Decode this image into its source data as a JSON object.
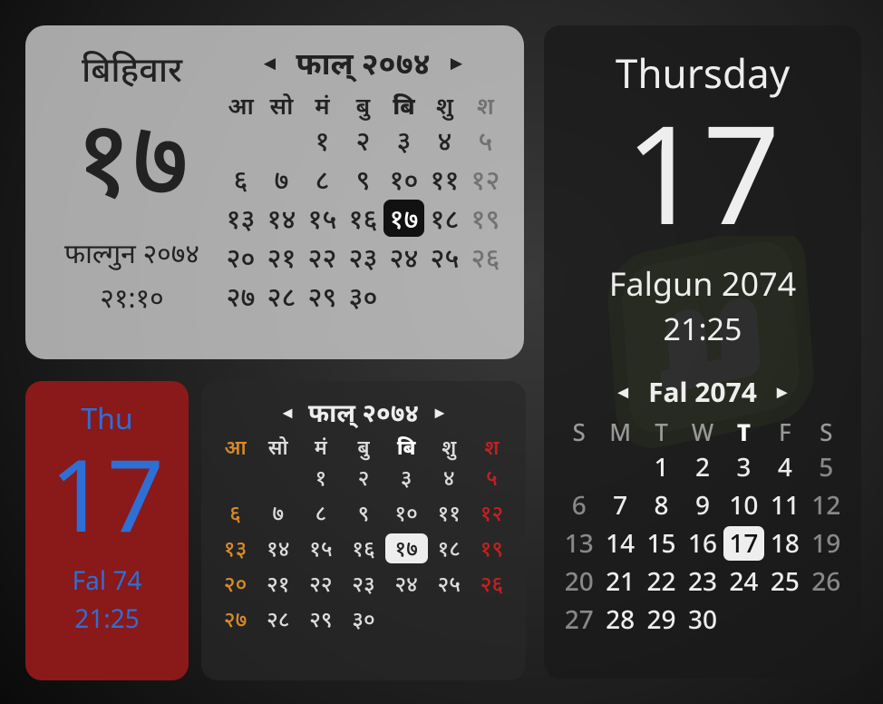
{
  "widget1": {
    "day_name": "बिहिवार",
    "big_date": "१७",
    "month_year": "फाल्गुन २०७४",
    "time": "२१:१०",
    "cal_title": "फाल् २०७४",
    "dow": [
      "आ",
      "सो",
      "मं",
      "बु",
      "बि",
      "शु",
      "श"
    ],
    "weeks": [
      [
        "",
        "",
        "१",
        "२",
        "३",
        "४",
        "५"
      ],
      [
        "६",
        "७",
        "८",
        "९",
        "१०",
        "११",
        "१२"
      ],
      [
        "१३",
        "१४",
        "१५",
        "१६",
        "१७",
        "१८",
        "१९"
      ],
      [
        "२०",
        "२१",
        "२२",
        "२३",
        "२४",
        "२५",
        "२६"
      ],
      [
        "२७",
        "२८",
        "२९",
        "३०",
        "",
        "",
        ""
      ]
    ],
    "today_col": 4,
    "today_row": 2
  },
  "widget2": {
    "day_name": "Thu",
    "big_date": "17",
    "month_year": "Fal 74",
    "time": "21:25"
  },
  "widget3": {
    "cal_title": "फाल्  २०७४",
    "dow": [
      "आ",
      "सो",
      "मं",
      "बु",
      "बि",
      "शु",
      "श"
    ],
    "weeks": [
      [
        "",
        "",
        "१",
        "२",
        "३",
        "४",
        "५"
      ],
      [
        "६",
        "७",
        "८",
        "९",
        "१०",
        "११",
        "१२"
      ],
      [
        "१३",
        "१४",
        "१५",
        "१६",
        "१७",
        "१८",
        "१९"
      ],
      [
        "२०",
        "२१",
        "२२",
        "२३",
        "२४",
        "२५",
        "२६"
      ],
      [
        "२७",
        "२८",
        "२९",
        "३०",
        "",
        "",
        ""
      ]
    ],
    "today_col": 4,
    "today_row": 2
  },
  "widget4": {
    "day_name": "Thursday",
    "big_date": "17",
    "month_year": "Falgun 2074",
    "time": "21:25",
    "cal_title": "Fal 2074",
    "dow": [
      "S",
      "M",
      "T",
      "W",
      "T",
      "F",
      "S"
    ],
    "weeks": [
      [
        "",
        "",
        "1",
        "2",
        "3",
        "4",
        "5"
      ],
      [
        "6",
        "7",
        "8",
        "9",
        "10",
        "11",
        "12"
      ],
      [
        "13",
        "14",
        "15",
        "16",
        "17",
        "18",
        "19"
      ],
      [
        "20",
        "21",
        "22",
        "23",
        "24",
        "25",
        "26"
      ],
      [
        "27",
        "28",
        "29",
        "30",
        "",
        "",
        ""
      ]
    ],
    "today_col": 4,
    "today_row": 2
  },
  "nav": {
    "prev": "◄",
    "next": "►"
  }
}
